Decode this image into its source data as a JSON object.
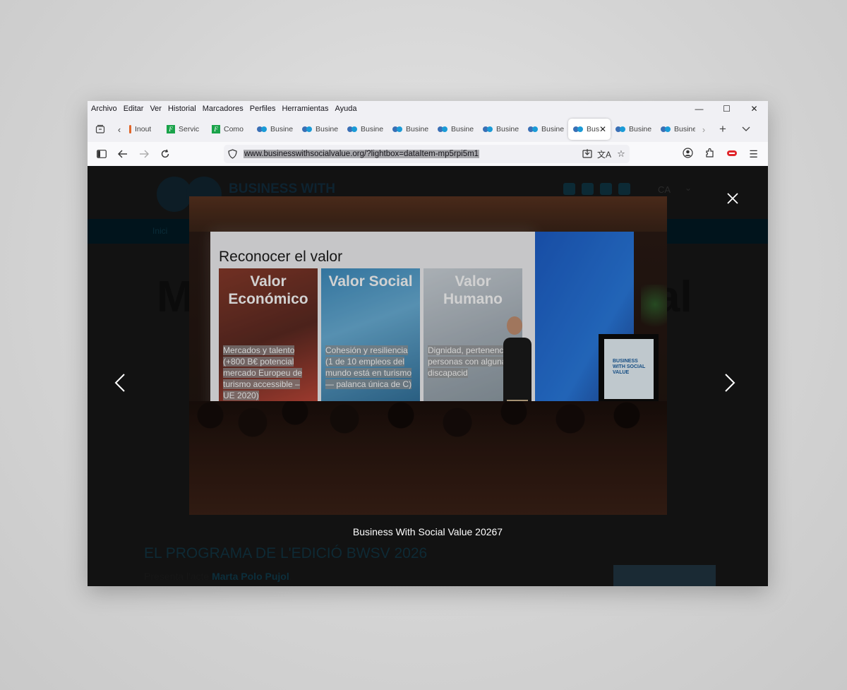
{
  "menubar": {
    "items": [
      "Archivo",
      "Editar",
      "Ver",
      "Historial",
      "Marcadores",
      "Perfiles",
      "Herramientas",
      "Ayuda"
    ]
  },
  "window_controls": {
    "minimize": "—",
    "maximize": "☐",
    "close": "✕"
  },
  "tabs": [
    {
      "label": "Inout",
      "favicon": "orange-bar-icon",
      "active": false
    },
    {
      "label": "Servic",
      "favicon": "f-green-icon",
      "active": false
    },
    {
      "label": "Como",
      "favicon": "f-green-icon",
      "active": false
    },
    {
      "label": "Busine",
      "favicon": "bwsv-icon",
      "active": false
    },
    {
      "label": "Busine",
      "favicon": "bwsv-icon",
      "active": false
    },
    {
      "label": "Busine",
      "favicon": "bwsv-icon",
      "active": false
    },
    {
      "label": "Busine",
      "favicon": "bwsv-icon",
      "active": false
    },
    {
      "label": "Busine",
      "favicon": "bwsv-icon",
      "active": false
    },
    {
      "label": "Busine",
      "favicon": "bwsv-icon",
      "active": false
    },
    {
      "label": "Busine",
      "favicon": "bwsv-icon",
      "active": false
    },
    {
      "label": "Bus",
      "favicon": "bwsv-icon",
      "active": true
    },
    {
      "label": "Busine",
      "favicon": "bwsv-icon",
      "active": false
    },
    {
      "label": "Busine",
      "favicon": "bwsv-icon",
      "active": false
    }
  ],
  "address_bar": {
    "url": "www.businesswithsocialvalue.org/?lightbox=dataItem-mp5rpi5m1"
  },
  "website": {
    "brand": "BUSINESS WITH",
    "nav_item": "Inici",
    "hero_left": "M",
    "hero_right": "al",
    "language": "CA",
    "program_title": "EL PROGRAMA DE L'EDICIÓ BWSV 2026",
    "program_line_prefix": "Presenta l'acte",
    "program_line_name": "Marta Polo Pujol",
    "program_line_suffix": "."
  },
  "lightbox": {
    "caption": "Business With Social Value 20267",
    "slide": {
      "title": "Reconocer el valor",
      "panels": [
        {
          "heading": "Valor Económico",
          "text": "Mercados y talento (+800 B€ potencial mercado Europeu de turismo accessible – UE 2020)"
        },
        {
          "heading": "Valor Social",
          "text": "Cohesión y resiliencia (1 de 10 empleos del mundo está en turismo — palanca única de C)"
        },
        {
          "heading": "Valor Humano",
          "text": "Dignidad, pertenencia 6 personas con alguna fo discapacid"
        }
      ],
      "podium_text": "BUSINESS WITH SOCIAL VALUE"
    }
  },
  "colors": {
    "bwsv_blue": "#1a9bd7",
    "overlay": "#121212",
    "tab_active_bg": "#ffffff"
  }
}
